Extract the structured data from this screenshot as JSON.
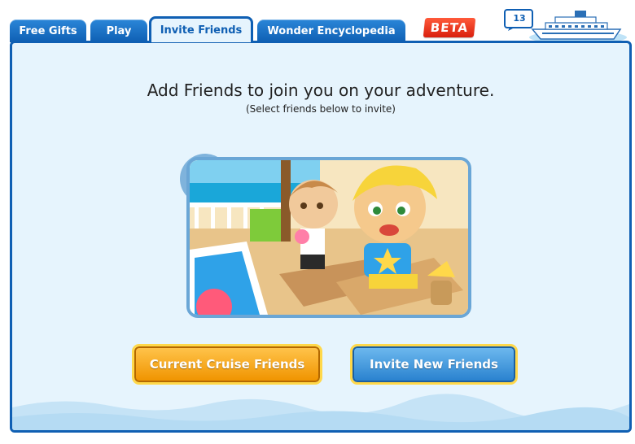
{
  "tabs": [
    {
      "label": "Free Gifts",
      "active": false
    },
    {
      "label": "Play",
      "active": false
    },
    {
      "label": "Invite Friends",
      "active": true
    },
    {
      "label": "Wonder Encyclopedia",
      "active": false
    }
  ],
  "beta_label": "BETA",
  "inbox": {
    "count": "13",
    "icon": "envelope-icon"
  },
  "ship_icon": "cruise-ship-icon",
  "main": {
    "heading": "Add Friends to join you on your adventure.",
    "subheading": "(Select friends below to invite)",
    "illustration": "cruise-deck-friends-illustration"
  },
  "buttons": {
    "current_friends": "Current Cruise Friends",
    "invite_new": "Invite New Friends"
  },
  "colors": {
    "tab_blue": "#0f5fb3",
    "panel_bg": "#e6f4fd",
    "beta_red": "#e8321a",
    "button_orange": "#f5a623",
    "button_blue": "#3b95dd",
    "button_outline": "#ffd84a"
  }
}
